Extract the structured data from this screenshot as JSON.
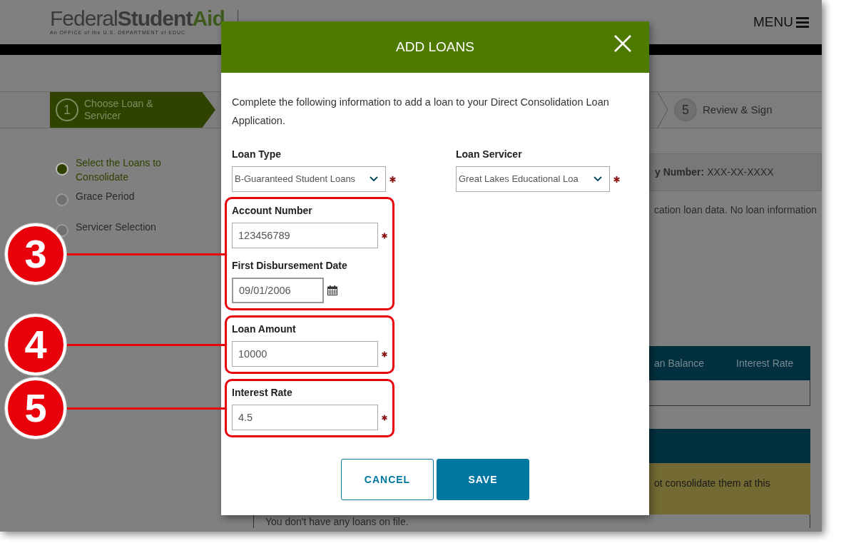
{
  "header": {
    "logo": {
      "part_1": "Federal",
      "part_2": "Student",
      "part_3": "Aid",
      "tagline": "An OFFICE of the U.S. DEPARTMENT of EDUC"
    },
    "menu": "MENU"
  },
  "steps": [
    {
      "number": "1",
      "label": "Choose Loan & Servicer",
      "selected": true
    },
    {
      "number": "5",
      "label": "Review & Sign",
      "selected": false
    }
  ],
  "sidebar": {
    "items": [
      {
        "label": "Select the Loans to Consolidate",
        "selected": true
      },
      {
        "label": "Grace Period",
        "selected": false
      },
      {
        "label": "Servicer Selection",
        "selected": false
      }
    ]
  },
  "content": {
    "ssn_label": "y Number:",
    "ssn_value": "XXX-XX-XXXX",
    "notice": "cation loan data. No loan information",
    "table": {
      "columns": [
        "an Balance",
        "Interest Rate"
      ]
    },
    "alert": "ot consolidate them at this",
    "empty_message": "You don't have any loans on file."
  },
  "modal": {
    "title": "ADD LOANS",
    "intro": "Complete the following information to add a loan to your Direct Consolidation Loan Application.",
    "selects": [
      {
        "label": "Loan Type",
        "value": "B-Guaranteed Student Loans",
        "required": true
      },
      {
        "label": "Loan Servicer",
        "value": "Great Lakes Educational Loa",
        "required": true
      }
    ],
    "groups": [
      {
        "callout": "3",
        "fields": [
          {
            "kind": "text",
            "label": "Account Number",
            "value": "123456789",
            "required": true
          },
          {
            "kind": "date",
            "label": "First Disbursement Date",
            "value": "09/01/2006",
            "required": false
          }
        ]
      },
      {
        "callout": "4",
        "fields": [
          {
            "kind": "text",
            "label": "Loan Amount",
            "value": "10000",
            "required": true
          }
        ]
      },
      {
        "callout": "5",
        "fields": [
          {
            "kind": "text",
            "label": "Interest Rate",
            "value": "4.5",
            "required": true
          }
        ]
      }
    ],
    "buttons": [
      {
        "label": "CANCEL",
        "kind": "secondary"
      },
      {
        "label": "SAVE",
        "kind": "primary"
      }
    ]
  }
}
